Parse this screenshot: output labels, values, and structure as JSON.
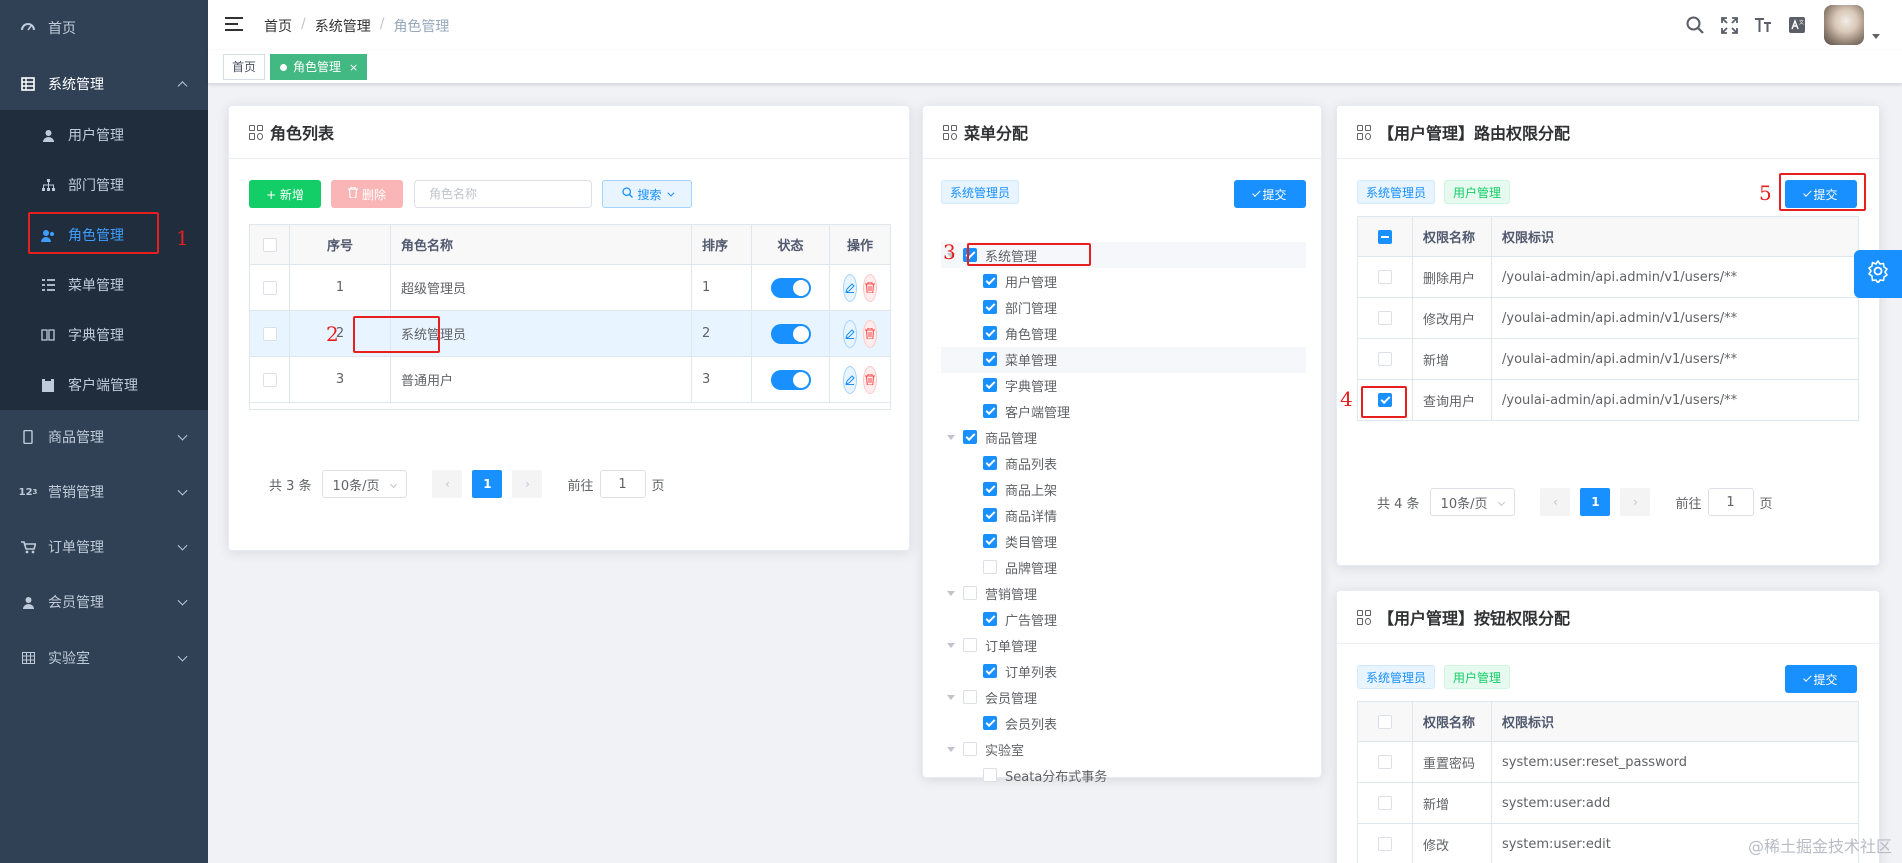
{
  "sidebar": {
    "items": [
      {
        "label": "首页",
        "icon": "dashboard-icon"
      },
      {
        "label": "系统管理",
        "icon": "system-icon"
      },
      {
        "label": "商品管理",
        "icon": "phone-icon"
      },
      {
        "label": "营销管理",
        "icon": "marketing-icon"
      },
      {
        "label": "订单管理",
        "icon": "cart-icon"
      },
      {
        "label": "会员管理",
        "icon": "user-icon"
      },
      {
        "label": "实验室",
        "icon": "lab-icon"
      }
    ],
    "system_sub": [
      {
        "label": "用户管理",
        "icon": "user-icon"
      },
      {
        "label": "部门管理",
        "icon": "tree-icon"
      },
      {
        "label": "角色管理",
        "icon": "role-icon"
      },
      {
        "label": "菜单管理",
        "icon": "menu-icon"
      },
      {
        "label": "字典管理",
        "icon": "book-icon"
      },
      {
        "label": "客户端管理",
        "icon": "client-icon"
      }
    ]
  },
  "navbar": {
    "breadcrumb": [
      "首页",
      "系统管理",
      "角色管理"
    ],
    "icons": [
      "search-icon",
      "fullscreen-icon",
      "font-size-icon",
      "language-icon"
    ]
  },
  "tags_view": {
    "tags": [
      {
        "label": "首页"
      },
      {
        "label": "角色管理",
        "close": "×"
      }
    ]
  },
  "role_card": {
    "title": "角色列表",
    "add_label": "+ 新增",
    "delete_label": "删除",
    "search_placeholder": "角色名称",
    "search_label": "搜索",
    "columns": [
      "序号",
      "角色名称",
      "排序",
      "状态",
      "操作"
    ],
    "rows": [
      {
        "idx": "1",
        "name": "超级管理员",
        "sort": "1"
      },
      {
        "idx": "2",
        "name": "系统管理员",
        "sort": "2"
      },
      {
        "idx": "3",
        "name": "普通用户",
        "sort": "3"
      }
    ],
    "pager": {
      "total": "共 3 条",
      "size": "10条/页",
      "page": "1",
      "goto": "前往",
      "goto_value": "1",
      "page_unit": "页"
    }
  },
  "menu_card": {
    "title": "菜单分配",
    "role_tag": "系统管理员",
    "submit_label": "提交",
    "tree": [
      {
        "label": "系统管理",
        "checked": true,
        "level": 0
      },
      {
        "label": "用户管理",
        "checked": true,
        "level": 1
      },
      {
        "label": "部门管理",
        "checked": true,
        "level": 1
      },
      {
        "label": "角色管理",
        "checked": true,
        "level": 1
      },
      {
        "label": "菜单管理",
        "checked": true,
        "level": 1
      },
      {
        "label": "字典管理",
        "checked": true,
        "level": 1
      },
      {
        "label": "客户端管理",
        "checked": true,
        "level": 1
      },
      {
        "label": "商品管理",
        "checked": true,
        "level": 0
      },
      {
        "label": "商品列表",
        "checked": true,
        "level": 1
      },
      {
        "label": "商品上架",
        "checked": true,
        "level": 1
      },
      {
        "label": "商品详情",
        "checked": true,
        "level": 1
      },
      {
        "label": "类目管理",
        "checked": true,
        "level": 1
      },
      {
        "label": "品牌管理",
        "checked": false,
        "level": 1
      },
      {
        "label": "营销管理",
        "checked": false,
        "level": 0
      },
      {
        "label": "广告管理",
        "checked": true,
        "level": 1
      },
      {
        "label": "订单管理",
        "checked": false,
        "level": 0
      },
      {
        "label": "订单列表",
        "checked": true,
        "level": 1
      },
      {
        "label": "会员管理",
        "checked": false,
        "level": 0
      },
      {
        "label": "会员列表",
        "checked": true,
        "level": 1
      },
      {
        "label": "实验室",
        "checked": false,
        "level": 0
      },
      {
        "label": "Seata分布式事务",
        "checked": false,
        "level": 1
      }
    ]
  },
  "route_card": {
    "title": "【用户管理】路由权限分配",
    "role_tag": "系统管理员",
    "menu_tag": "用户管理",
    "submit_label": "提交",
    "columns": [
      "权限名称",
      "权限标识"
    ],
    "rows": [
      {
        "name": "删除用户",
        "perm": "/youlai-admin/api.admin/v1/users/**",
        "checked": false
      },
      {
        "name": "修改用户",
        "perm": "/youlai-admin/api.admin/v1/users/**",
        "checked": false
      },
      {
        "name": "新增",
        "perm": "/youlai-admin/api.admin/v1/users/**",
        "checked": false
      },
      {
        "name": "查询用户",
        "perm": "/youlai-admin/api.admin/v1/users/**",
        "checked": true
      }
    ],
    "pager": {
      "total": "共 4 条",
      "size": "10条/页",
      "page": "1",
      "goto": "前往",
      "goto_value": "1",
      "page_unit": "页"
    }
  },
  "button_card": {
    "title": "【用户管理】按钮权限分配",
    "role_tag": "系统管理员",
    "menu_tag": "用户管理",
    "submit_label": "提交",
    "columns": [
      "权限名称",
      "权限标识"
    ],
    "rows": [
      {
        "name": "重置密码",
        "perm": "system:user:reset_password"
      },
      {
        "name": "新增",
        "perm": "system:user:add"
      },
      {
        "name": "修改",
        "perm": "system:user:edit"
      }
    ]
  },
  "annotations": [
    "1",
    "2",
    "3",
    "4",
    "5"
  ],
  "watermark": "@稀土掘金技术社区",
  "colors": {
    "primary": "#1890ff",
    "sidebar_bg": "#304156",
    "submenu_bg": "#1f2d3d",
    "success": "#13ce66",
    "annotation": "#e81f1f"
  }
}
